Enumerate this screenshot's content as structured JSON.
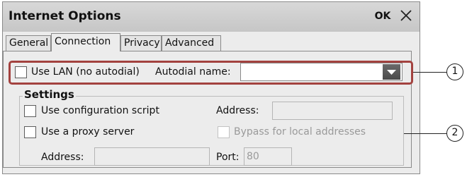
{
  "dialog": {
    "title": "Internet Options",
    "ok_label": "OK"
  },
  "tabs": [
    {
      "label": "General"
    },
    {
      "label": "Connection"
    },
    {
      "label": "Privacy"
    },
    {
      "label": "Advanced"
    }
  ],
  "connection": {
    "use_lan_label": "Use LAN (no autodial)",
    "use_lan_checked": false,
    "autodial_label": "Autodial name:",
    "autodial_value": ""
  },
  "settings": {
    "title": "Settings",
    "config_script_label": "Use configuration script",
    "config_address_label": "Address:",
    "config_address_value": "",
    "proxy_label": "Use a proxy server",
    "bypass_label": "Bypass for local addresses",
    "proxy_address_label": "Address:",
    "proxy_address_value": "",
    "port_label": "Port:",
    "port_value": "80"
  },
  "callouts": [
    "1",
    "2"
  ],
  "colors": {
    "highlight": "#a3423f",
    "dialog_bg": "#ececec",
    "titlebar": "#c6c6c6"
  }
}
